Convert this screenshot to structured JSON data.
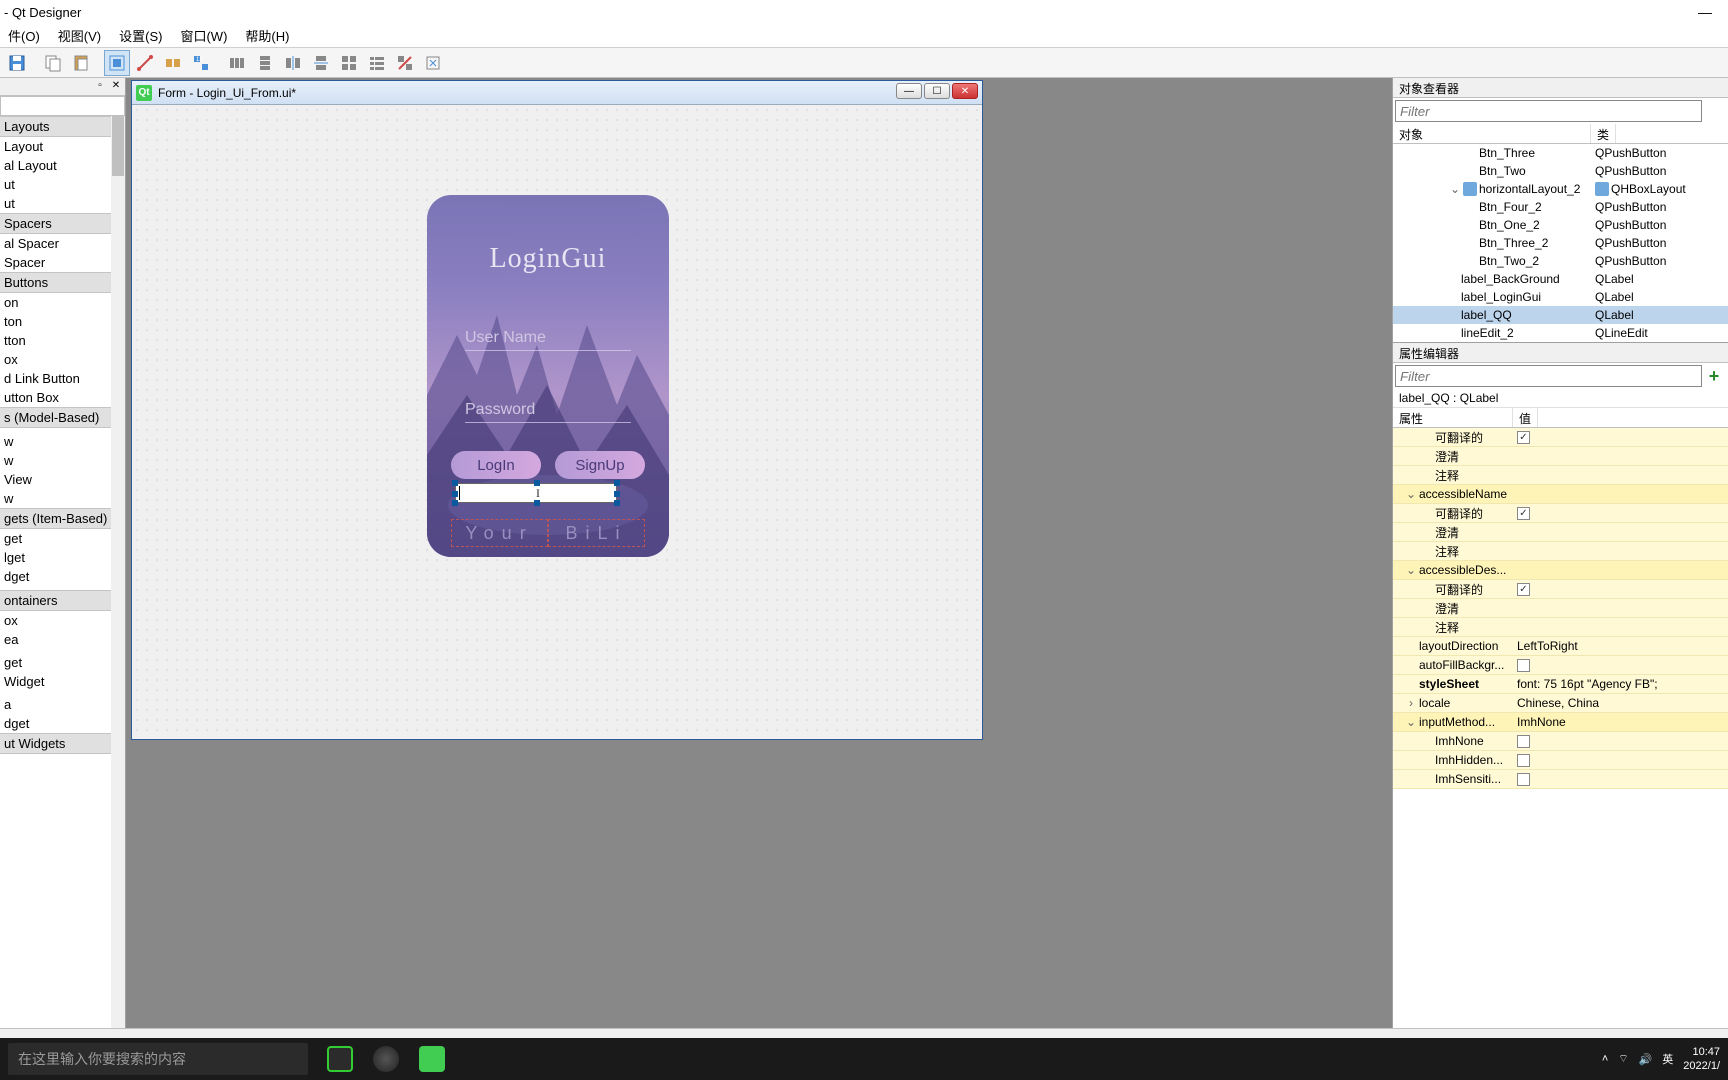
{
  "window": {
    "title": " - Qt Designer",
    "minimize": "—"
  },
  "menu": [
    "件(O)",
    "视图(V)",
    "设置(S)",
    "窗口(W)",
    "帮助(H)"
  ],
  "widgetbox": {
    "categories": [
      {
        "label": "Layouts",
        "items": [
          "Layout",
          "al Layout",
          "ut",
          "ut"
        ]
      },
      {
        "label": "Spacers",
        "items": [
          "al Spacer",
          "Spacer"
        ]
      },
      {
        "label": "Buttons",
        "items": [
          "on",
          "ton",
          "tton",
          "ox",
          "d Link Button",
          "utton Box"
        ]
      },
      {
        "label": "s (Model-Based)",
        "items": [
          "",
          "w",
          "w",
          "View",
          "w"
        ]
      },
      {
        "label": "gets (Item-Based)",
        "items": [
          "get",
          "lget",
          "dget",
          ""
        ]
      },
      {
        "label": "ontainers",
        "items": [
          "ox",
          "ea",
          "",
          "get",
          "Widget",
          "",
          "a",
          "dget"
        ]
      },
      {
        "label": "ut Widgets",
        "items": []
      }
    ]
  },
  "form": {
    "title": "Form - Login_Ui_From.ui*",
    "login": {
      "heading": "LoginGui",
      "username": "User Name",
      "password": "Password",
      "login_btn": "LogIn",
      "signup_btn": "SignUp",
      "bottom_left": "Your",
      "bottom_right": "BiLi"
    }
  },
  "object_inspector": {
    "title": "对象查看器",
    "filter_placeholder": "Filter",
    "col_object": "对象",
    "col_class": "类",
    "rows": [
      {
        "indent": 80,
        "name": "Btn_Three",
        "class": "QPushButton"
      },
      {
        "indent": 80,
        "name": "Btn_Two",
        "class": "QPushButton"
      },
      {
        "indent": 50,
        "name": "horizontalLayout_2",
        "class": "QHBoxLayout",
        "expander": "⌄",
        "layout": true
      },
      {
        "indent": 80,
        "name": "Btn_Four_2",
        "class": "QPushButton"
      },
      {
        "indent": 80,
        "name": "Btn_One_2",
        "class": "QPushButton"
      },
      {
        "indent": 80,
        "name": "Btn_Three_2",
        "class": "QPushButton"
      },
      {
        "indent": 80,
        "name": "Btn_Two_2",
        "class": "QPushButton"
      },
      {
        "indent": 62,
        "name": "label_BackGround",
        "class": "QLabel"
      },
      {
        "indent": 62,
        "name": "label_LoginGui",
        "class": "QLabel"
      },
      {
        "indent": 62,
        "name": "label_QQ",
        "class": "QLabel",
        "selected": true
      },
      {
        "indent": 62,
        "name": "lineEdit_2",
        "class": "QLineEdit"
      }
    ]
  },
  "property_editor": {
    "title": "属性编辑器",
    "filter_placeholder": "Filter",
    "selection": "label_QQ : QLabel",
    "col_prop": "属性",
    "col_val": "值",
    "rows": [
      {
        "indent": 36,
        "name": "可翻译的",
        "checkbox": true,
        "checked": true
      },
      {
        "indent": 36,
        "name": "澄清",
        "value": ""
      },
      {
        "indent": 36,
        "name": "注释",
        "value": ""
      },
      {
        "indent": 20,
        "name": "accessibleName",
        "expander": "⌄",
        "group": true
      },
      {
        "indent": 36,
        "name": "可翻译的",
        "checkbox": true,
        "checked": true
      },
      {
        "indent": 36,
        "name": "澄清",
        "value": ""
      },
      {
        "indent": 36,
        "name": "注释",
        "value": ""
      },
      {
        "indent": 20,
        "name": "accessibleDes...",
        "expander": "⌄",
        "group": true
      },
      {
        "indent": 36,
        "name": "可翻译的",
        "checkbox": true,
        "checked": true
      },
      {
        "indent": 36,
        "name": "澄清",
        "value": ""
      },
      {
        "indent": 36,
        "name": "注释",
        "value": ""
      },
      {
        "indent": 20,
        "name": "layoutDirection",
        "value": "LeftToRight"
      },
      {
        "indent": 20,
        "name": "autoFillBackgr...",
        "checkbox": true,
        "checked": false
      },
      {
        "indent": 20,
        "name": "styleSheet",
        "value": "font: 75 16pt \"Agency FB\";",
        "bold": true
      },
      {
        "indent": 20,
        "name": "locale",
        "value": "Chinese, China",
        "expander": "›"
      },
      {
        "indent": 20,
        "name": "inputMethod...",
        "value": "ImhNone",
        "expander": "⌄",
        "group": true
      },
      {
        "indent": 36,
        "name": "ImhNone",
        "checkbox": true,
        "checked": false
      },
      {
        "indent": 36,
        "name": "ImhHidden...",
        "checkbox": true,
        "checked": false
      },
      {
        "indent": 36,
        "name": "ImhSensiti...",
        "checkbox": true,
        "checked": false
      }
    ]
  },
  "taskbar": {
    "search_placeholder": "在这里输入你要搜索的内容",
    "ime": "英",
    "time": "10:47",
    "date": "2022/1/"
  }
}
